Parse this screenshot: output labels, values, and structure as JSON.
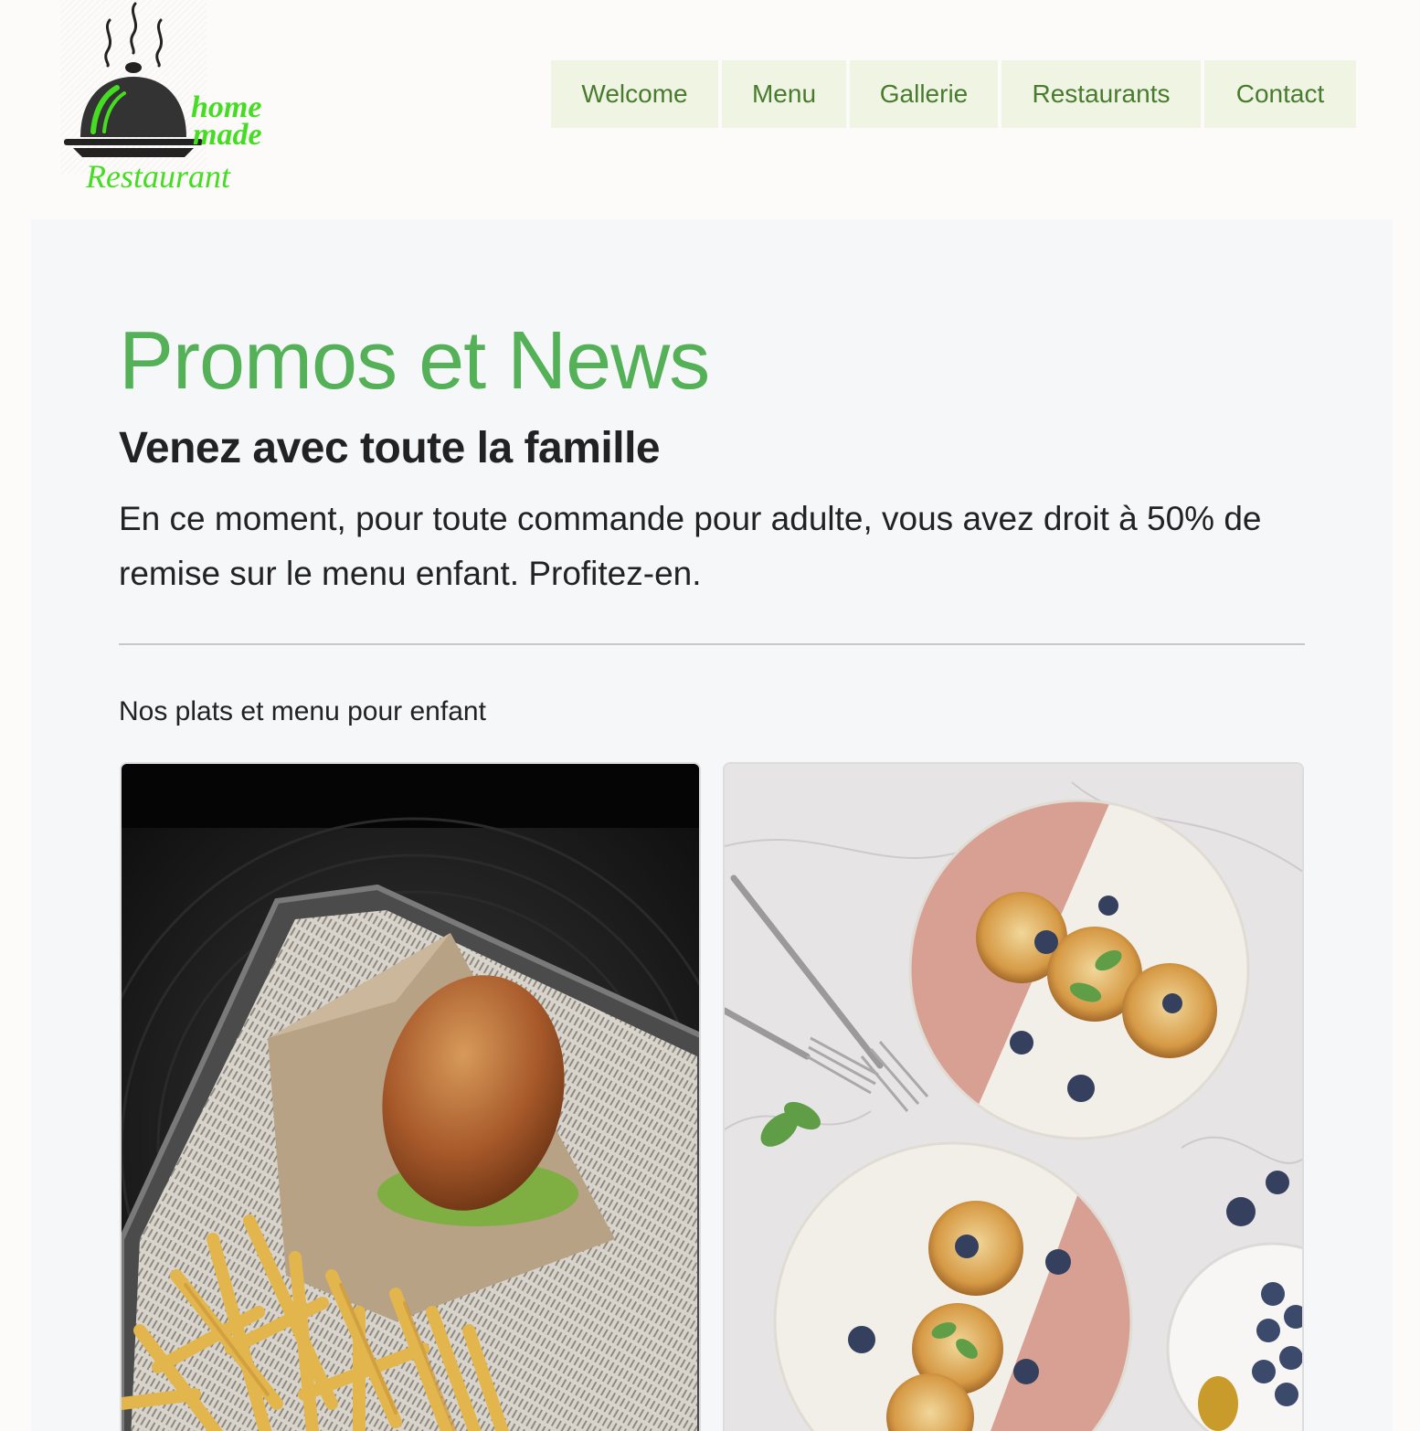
{
  "logo": {
    "line1": "home",
    "line2": "made",
    "line3": "Restaurant",
    "brand_color": "#44dd22",
    "icon": "cloche-icon"
  },
  "nav": {
    "items": [
      {
        "label": "Welcome"
      },
      {
        "label": "Menu"
      },
      {
        "label": "Gallerie"
      },
      {
        "label": "Restaurants"
      },
      {
        "label": "Contact"
      }
    ],
    "bg_color": "#eff4e3",
    "text_color": "#497b2e"
  },
  "main": {
    "title": "Promos et News",
    "subtitle": "Venez avec toute la famille",
    "lead": "En ce moment, pour toute commande pour adulte, vous avez droit à 50% de remise sur le menu enfant. Profitez-en.",
    "section_label": "Nos plats et menu pour enfant",
    "title_color": "#54b157"
  },
  "cards": [
    {
      "image": "burger-and-fries-photo"
    },
    {
      "image": "pancakes-with-blueberries-photo"
    }
  ]
}
